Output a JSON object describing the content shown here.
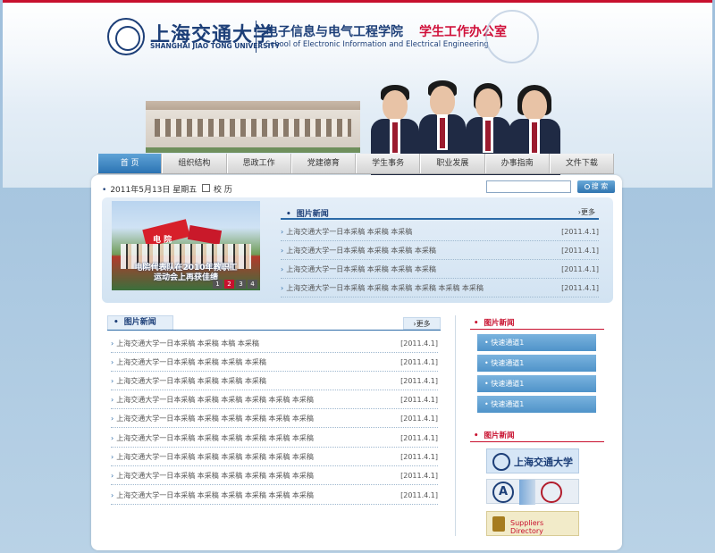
{
  "colors": {
    "accent": "#c8102e",
    "brand_blue": "#1d3f78",
    "nav_active": "#2b73b3"
  },
  "header": {
    "university_cn": "上海交通大学",
    "university_en": "SHANGHAI JIAO TONG UNIVERSITY",
    "school_cn": "电子信息与电气工程学院",
    "office_cn": "学生工作办公室",
    "school_en": "School of Electronic Information and Electrical Engineering"
  },
  "nav": {
    "items": [
      {
        "label": "首 页"
      },
      {
        "label": "组织结构"
      },
      {
        "label": "思政工作"
      },
      {
        "label": "党建德育"
      },
      {
        "label": "学生事务"
      },
      {
        "label": "职业发展"
      },
      {
        "label": "办事指南"
      },
      {
        "label": "文件下载"
      }
    ]
  },
  "toolbar": {
    "date": "2011年5月13日 星期五",
    "calendar_label": "校 历",
    "search_placeholder": "",
    "search_label": "搜 索"
  },
  "slideshow": {
    "badge": "电 院",
    "caption_line1": "电院代表队在2010年教职工",
    "caption_line2": "运动会上再获佳绩",
    "pages": [
      "1",
      "2",
      "3",
      "4"
    ],
    "active_page": "2"
  },
  "top_news": {
    "title": "图片新闻",
    "more": "更多",
    "items": [
      {
        "text": "上海交通大学一日本采稿 本采稿 本采稿",
        "date": "[2011.4.1]"
      },
      {
        "text": "上海交通大学一日本采稿 本采稿 本采稿 本采稿",
        "date": "[2011.4.1]"
      },
      {
        "text": "上海交通大学一日本采稿 本采稿 本采稿 本采稿",
        "date": "[2011.4.1]"
      },
      {
        "text": "上海交通大学一日本采稿 本采稿 本采稿 本采稿 本采稿 本采稿",
        "date": "[2011.4.1]"
      }
    ]
  },
  "lower_news": {
    "title": "图片新闻",
    "more": "更多",
    "items": [
      {
        "text": "上海交通大学一日本采稿 本采稿 本稿 本采稿",
        "date": "[2011.4.1]"
      },
      {
        "text": "上海交通大学一日本采稿 本采稿 本采稿 本采稿",
        "date": "[2011.4.1]"
      },
      {
        "text": "上海交通大学一日本采稿 本采稿 本采稿 本采稿",
        "date": "[2011.4.1]"
      },
      {
        "text": "上海交通大学一日本采稿 本采稿 本采稿 本采稿 本采稿 本采稿",
        "date": "[2011.4.1]"
      },
      {
        "text": "上海交通大学一日本采稿 本采稿 本采稿 本采稿 本采稿 本采稿",
        "date": "[2011.4.1]"
      },
      {
        "text": "上海交通大学一日本采稿 本采稿 本采稿 本采稿 本采稿 本采稿",
        "date": "[2011.4.1]"
      },
      {
        "text": "上海交通大学一日本采稿 本采稿 本采稿 本采稿 本采稿 本采稿",
        "date": "[2011.4.1]"
      },
      {
        "text": "上海交通大学一日本采稿 本采稿 本采稿 本采稿 本采稿 本采稿",
        "date": "[2011.4.1]"
      },
      {
        "text": "上海交通大学一日本采稿 本采稿 本采稿 本采稿 本采稿 本采稿",
        "date": "[2011.4.1]"
      }
    ]
  },
  "sidebar": {
    "quick_title": "图片新闻",
    "quick_links": [
      {
        "label": "快速通道1"
      },
      {
        "label": "快速通道1"
      },
      {
        "label": "快速通道1"
      },
      {
        "label": "快速通道1"
      }
    ],
    "partners_title": "图片新闻",
    "partner_sjtu": "上海交通大学",
    "partner_supplier": "Suppliers Directory"
  }
}
